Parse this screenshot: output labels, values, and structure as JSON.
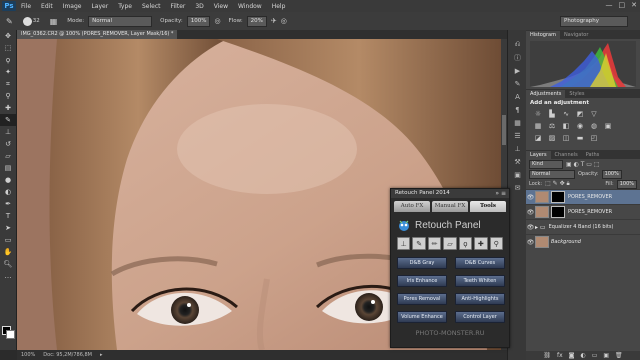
{
  "app": {
    "logo_text": "Ps",
    "menu": [
      "File",
      "Edit",
      "Image",
      "Layer",
      "Type",
      "Select",
      "Filter",
      "3D",
      "View",
      "Window",
      "Help"
    ],
    "window_controls": [
      "—",
      "□",
      "✕"
    ]
  },
  "options_bar": {
    "brush_size": "32",
    "mode_label": "Mode:",
    "mode_value": "Normal",
    "opacity_label": "Opacity:",
    "opacity_value": "100%",
    "flow_label": "Flow:",
    "flow_value": "20%",
    "workspace": "Photography"
  },
  "document": {
    "tab_title": "IMG_0362.CR2 @ 100% (PORES_REMOVER, Layer Mask/16) *",
    "status_zoom": "100%",
    "status_doc": "Doc: 95,2M/786,8M"
  },
  "panels": {
    "histogram_tabs": [
      "Histogram",
      "Navigator"
    ],
    "adjustments_tabs": [
      "Adjustments",
      "Styles"
    ],
    "adjustments_title": "Add an adjustment",
    "layers_tabs": [
      "Layers",
      "Channels",
      "Paths"
    ],
    "layers_kind": "Kind",
    "blend_mode": "Normal",
    "opacity_label": "Opacity:",
    "opacity_value": "100%",
    "lock_label": "Lock:",
    "fill_label": "Fill:",
    "fill_value": "100%",
    "layers": [
      {
        "name": "PORES_REMOVER"
      },
      {
        "name": "PORES_REMOVER"
      },
      {
        "name": "Equalizer 4 Band (16 bits)"
      },
      {
        "name": "Background"
      }
    ]
  },
  "retouch_panel": {
    "window_title": "Retouch Panel 2014",
    "tabs": [
      "Auto FX",
      "Manual FX",
      "Tools"
    ],
    "heading": "Retouch Panel",
    "buttons": [
      "D&B Gray",
      "D&B Curves",
      "Iris Enhance",
      "Teeth Whiten",
      "Pores Removal",
      "Anti-Highlights",
      "Volume Enhance",
      "Control Layer"
    ],
    "footer": "PHOTO-MONSTER.RU"
  }
}
